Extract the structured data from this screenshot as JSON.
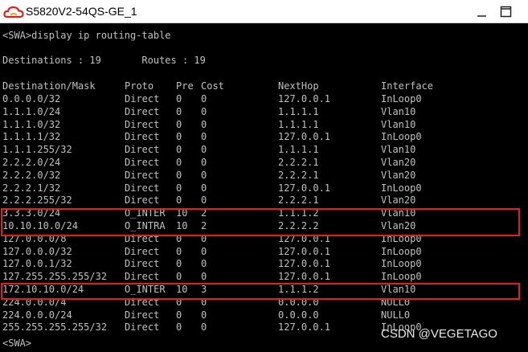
{
  "window": {
    "title": "S5820V2-54QS-GE_1",
    "icon": "cloud-logo-icon",
    "controls": [
      "minimize-icon",
      "maximize-icon"
    ]
  },
  "terminal": {
    "command": "<SWA>display ip routing-table",
    "summary": "Destinations : 19       Routes : 19",
    "headers": [
      "Destination/Mask",
      "Proto",
      "Pre",
      "Cost",
      "NextHop",
      "Interface"
    ],
    "routes": [
      [
        "0.0.0.0/32",
        "Direct",
        "0",
        "0",
        "127.0.0.1",
        "InLoop0"
      ],
      [
        "1.1.1.0/24",
        "Direct",
        "0",
        "0",
        "1.1.1.1",
        "Vlan10"
      ],
      [
        "1.1.1.0/32",
        "Direct",
        "0",
        "0",
        "1.1.1.1",
        "Vlan10"
      ],
      [
        "1.1.1.1/32",
        "Direct",
        "0",
        "0",
        "127.0.0.1",
        "InLoop0"
      ],
      [
        "1.1.1.255/32",
        "Direct",
        "0",
        "0",
        "1.1.1.1",
        "Vlan10"
      ],
      [
        "2.2.2.0/24",
        "Direct",
        "0",
        "0",
        "2.2.2.1",
        "Vlan20"
      ],
      [
        "2.2.2.0/32",
        "Direct",
        "0",
        "0",
        "2.2.2.1",
        "Vlan20"
      ],
      [
        "2.2.2.1/32",
        "Direct",
        "0",
        "0",
        "127.0.0.1",
        "InLoop0"
      ],
      [
        "2.2.2.255/32",
        "Direct",
        "0",
        "0",
        "2.2.2.1",
        "Vlan20"
      ],
      [
        "3.3.3.0/24",
        "O_INTER",
        "10",
        "2",
        "1.1.1.2",
        "Vlan10"
      ],
      [
        "10.10.10.0/24",
        "O_INTRA",
        "10",
        "2",
        "2.2.2.2",
        "Vlan20"
      ],
      [
        "127.0.0.0/8",
        "Direct",
        "0",
        "0",
        "127.0.0.1",
        "InLoop0"
      ],
      [
        "127.0.0.0/32",
        "Direct",
        "0",
        "0",
        "127.0.0.1",
        "InLoop0"
      ],
      [
        "127.0.0.1/32",
        "Direct",
        "0",
        "0",
        "127.0.0.1",
        "InLoop0"
      ],
      [
        "127.255.255.255/32",
        "Direct",
        "0",
        "0",
        "127.0.0.1",
        "InLoop0"
      ],
      [
        "172.10.10.0/24",
        "O_INTER",
        "10",
        "3",
        "1.1.1.2",
        "Vlan10"
      ],
      [
        "224.0.0.0/4",
        "Direct",
        "0",
        "0",
        "0.0.0.0",
        "NULL0"
      ],
      [
        "224.0.0.0/24",
        "Direct",
        "0",
        "0",
        "0.0.0.0",
        "NULL0"
      ],
      [
        "255.255.255.255/32",
        "Direct",
        "0",
        "0",
        "127.0.0.1",
        "InLoop0"
      ]
    ],
    "prompt": "<SWA>"
  },
  "highlight_color": "#e41e1e",
  "watermark": "CSDN @VEGETAGO"
}
